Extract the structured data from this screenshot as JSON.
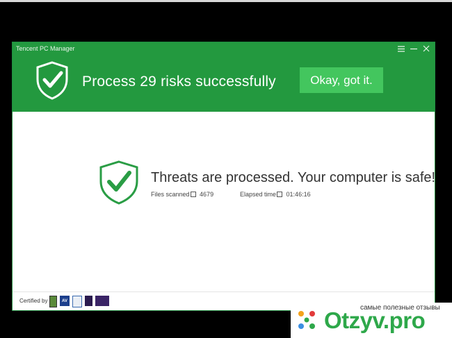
{
  "app": {
    "title": "Tencent PC Manager",
    "header_message": "Process 29 risks successfully",
    "ok_button_label": "Okay, got it.",
    "accent_color": "#23993f",
    "button_color": "#43c65e"
  },
  "window_controls": {
    "menu_icon": "menu-icon",
    "minimize_icon": "minimize-icon",
    "close_icon": "close-icon"
  },
  "result": {
    "title": "Threats are processed. Your computer is safe!",
    "files_scanned_label": "Files scanned",
    "files_scanned_value": "4679",
    "elapsed_time_label": "Elapsed time",
    "elapsed_time_value": "01:46:16"
  },
  "footer": {
    "certified_label": "Certified by",
    "badges": [
      {
        "icon": "certification-badge-1",
        "text": ""
      },
      {
        "icon": "av-test-badge",
        "text": "AV"
      },
      {
        "icon": "certification-badge-3",
        "text": ""
      },
      {
        "icon": "certification-badge-4",
        "text": ""
      },
      {
        "icon": "certification-badge-5",
        "text": ""
      }
    ]
  },
  "watermark": {
    "tagline": "самые полезные отзывы",
    "brand": "Otzyv.pro"
  }
}
